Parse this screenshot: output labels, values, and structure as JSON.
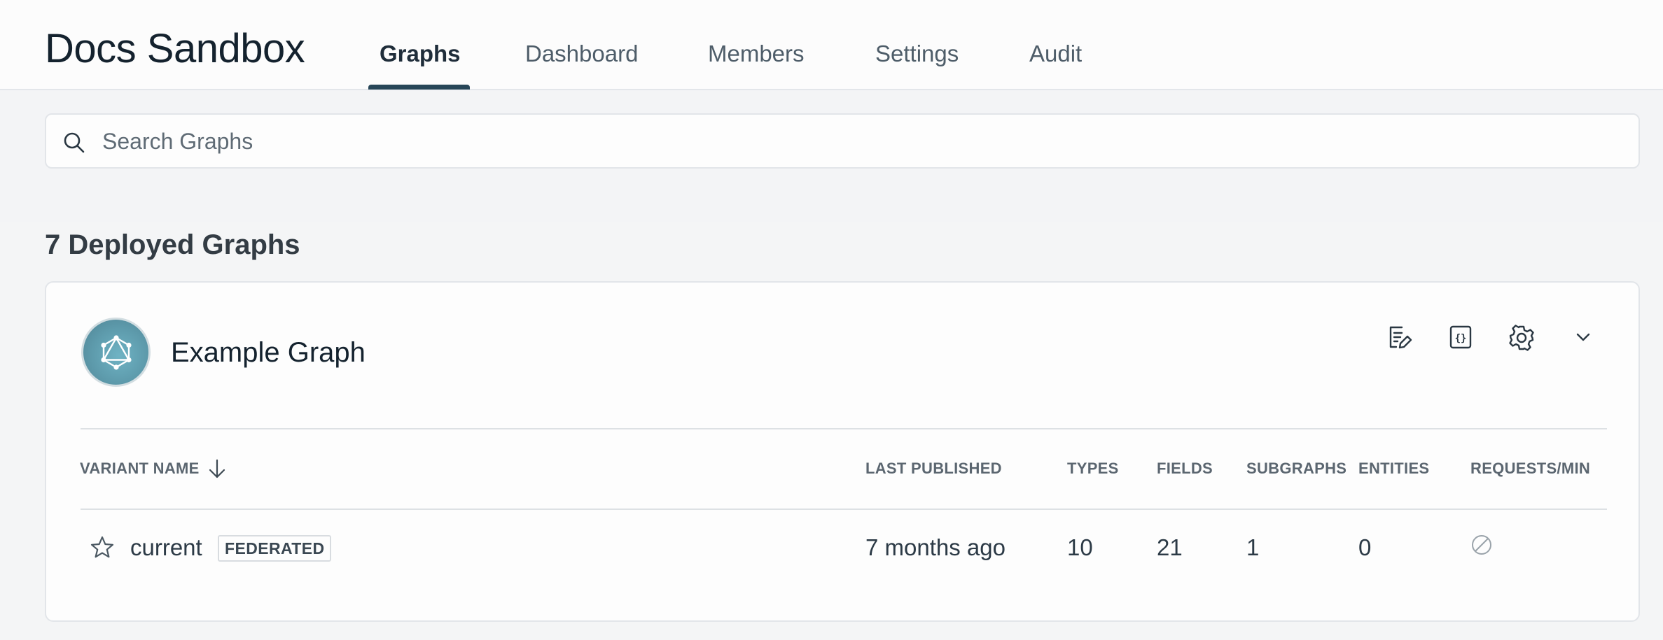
{
  "header": {
    "org_title": "Docs Sandbox",
    "tabs": [
      {
        "label": "Graphs",
        "active": true
      },
      {
        "label": "Dashboard",
        "active": false
      },
      {
        "label": "Members",
        "active": false
      },
      {
        "label": "Settings",
        "active": false
      },
      {
        "label": "Audit",
        "active": false
      }
    ]
  },
  "search": {
    "placeholder": "Search Graphs",
    "value": "",
    "icon": "search-icon"
  },
  "graphs_section": {
    "title": "7 Deployed Graphs"
  },
  "graph_card": {
    "name": "Example Graph",
    "avatar_icon": "graphql-logo-icon",
    "actions": [
      {
        "icon": "edit-document-icon"
      },
      {
        "icon": "code-brackets-icon"
      },
      {
        "icon": "gear-icon"
      },
      {
        "icon": "chevron-down-icon"
      }
    ],
    "table": {
      "sort_icon": "arrow-down-icon",
      "columns": [
        "VARIANT NAME",
        "LAST PUBLISHED",
        "TYPES",
        "FIELDS",
        "SUBGRAPHS",
        "ENTITIES",
        "REQUESTS/MIN"
      ],
      "rows": [
        {
          "favorite_icon": "star-outline-icon",
          "variant_name": "current",
          "badge": "FEDERATED",
          "last_published": "7 months ago",
          "types": "10",
          "fields": "21",
          "subgraphs": "1",
          "entities": "0",
          "requests_icon": "no-data-icon"
        }
      ]
    }
  },
  "colors": {
    "background": "#f3f4f6",
    "card": "#fdfdfd",
    "tab_indicator": "#274658",
    "avatar": "#5d9aab",
    "text_primary": "#14222e",
    "text_muted": "#5b6670"
  }
}
